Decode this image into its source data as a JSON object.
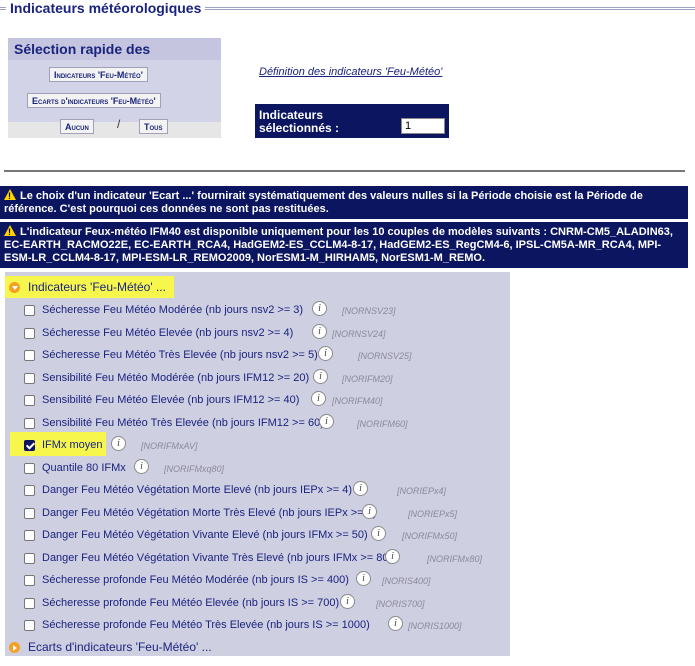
{
  "section": {
    "title": "Indicateurs météorologiques"
  },
  "quick": {
    "title": "Sélection rapide des Indicateurs",
    "btn_feu": "Indicateurs 'Feu-Météo'",
    "btn_ecarts": "Ecarts d'indicateurs 'Feu-Météo'",
    "btn_aucun": "Aucun",
    "separator": "/",
    "btn_tous": "Tous"
  },
  "definition_link": "Définition des indicateurs 'Feu-Météo'",
  "selected": {
    "label": "Indicateurs sélectionnés :",
    "value": "1"
  },
  "alerts": [
    "Le choix d'un indicateur 'Ecart ...' fournirait systématiquement des valeurs nulles si la Période choisie est la Période de référence. C'est pourquoi ces données ne sont pas restituées.",
    "L'indicateur Feux-météo IFM40 est disponible uniquement pour les 10 couples de modèles suivants : CNRM-CM5_ALADIN63, EC-EARTH_RACMO22E, EC-EARTH_RCA4, HadGEM2-ES_CCLM4-8-17, HadGEM2-ES_RegCM4-6, IPSL-CM5A-MR_RCA4, MPI-ESM-LR_CCLM4-8-17, MPI-ESM-LR_REMO2009, NorESM1-M_HIRHAM5, NorESM1-M_REMO."
  ],
  "groups": {
    "feu_label": "Indicateurs 'Feu-Météo' ...",
    "ecarts_label": "Ecarts d'indicateurs 'Feu-Météo' ..."
  },
  "indicators": [
    {
      "label": "Sécheresse Feu Météo Modérée (nb jours nsv2 >= 3)",
      "code": "[NORNSV23]",
      "checked": false
    },
    {
      "label": "Sécheresse Feu Météo Elevée (nb jours nsv2 >= 4)",
      "code": "[NORNSV24]",
      "checked": false
    },
    {
      "label": "Sécheresse Feu Météo Très Elevée (nb jours nsv2 >= 5)",
      "code": "[NORNSV25]",
      "checked": false
    },
    {
      "label": "Sensibilité Feu Météo Modérée (nb jours IFM12 >= 20)",
      "code": "[NORIFM20]",
      "checked": false
    },
    {
      "label": "Sensibilité Feu Météo Elevée (nb jours IFM12 >= 40)",
      "code": "[NORIFM40]",
      "checked": false
    },
    {
      "label": "Sensibilité Feu Météo Très Elevée (nb jours IFM12 >= 60)",
      "code": "[NORIFM60]",
      "checked": false
    },
    {
      "label": "IFMx moyen",
      "code": "[NORIFMxAV]",
      "checked": true
    },
    {
      "label": "Quantile 80 IFMx",
      "code": "[NORIFMxq80]",
      "checked": false
    },
    {
      "label": "Danger Feu Météo Végétation Morte Elevé (nb jours IEPx >= 4)",
      "code": "[NORIEPx4]",
      "checked": false
    },
    {
      "label": "Danger Feu Météo Végétation Morte Très Elevé (nb jours IEPx >= 5)",
      "code": "[NORIEPx5]",
      "checked": false
    },
    {
      "label": "Danger Feu Météo Végétation Vivante Elevé (nb jours IFMx >= 50)",
      "code": "[NORIFMx50]",
      "checked": false
    },
    {
      "label": "Danger Feu Météo Végétation Vivante Très Elevé (nb jours IFMx >= 80)",
      "code": "[NORIFMx80]",
      "checked": false
    },
    {
      "label": "Sécheresse profonde Feu Météo Modérée (nb jours IS >= 400)",
      "code": "[NORIS400]",
      "checked": false
    },
    {
      "label": "Sécheresse profonde Feu Météo Elevée (nb jours IS >= 700)",
      "code": "[NORIS700]",
      "checked": false
    },
    {
      "label": "Sécheresse profonde Feu Météo Très Elevée (nb jours IS >= 1000)",
      "code": "[NORIS1000]",
      "checked": false
    }
  ],
  "icons": {
    "info": "info-icon",
    "warning": "warning-icon",
    "expand": "chevron-down-icon",
    "collapsed": "chevron-right-icon"
  },
  "colors": {
    "navy": "#0b1560",
    "highlight": "#f6f64d",
    "panel": "#cfcfe2"
  }
}
